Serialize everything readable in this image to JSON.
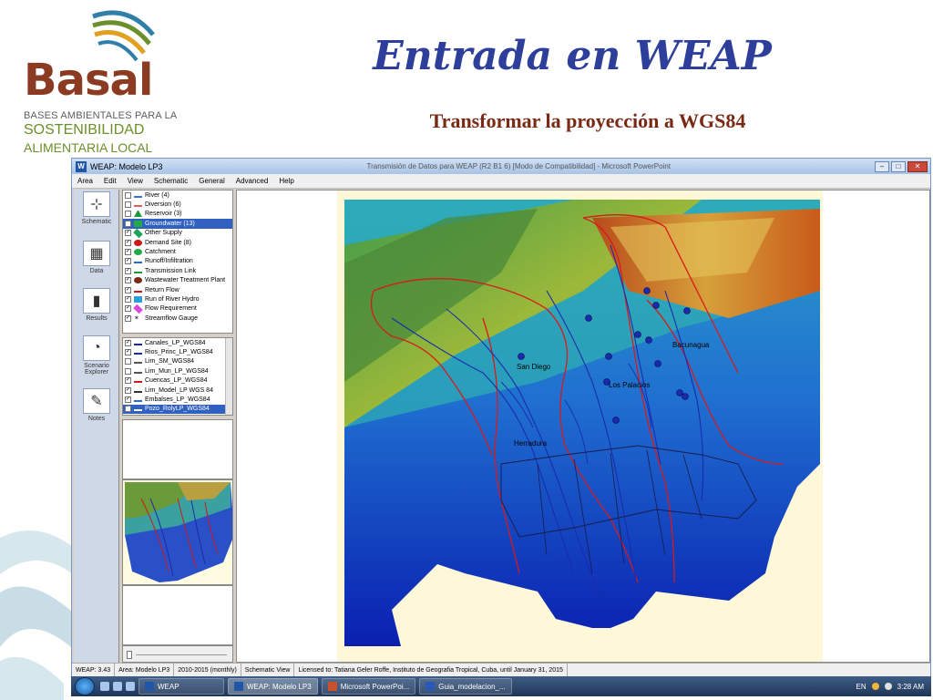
{
  "slide": {
    "title": "Entrada en WEAP",
    "subtitle": "Transformar la proyección a WGS84"
  },
  "logo": {
    "brand": "Basal",
    "line1": "BASES AMBIENTALES PARA LA",
    "line2": "SOSTENIBILIDAD",
    "line3": "ALIMENTARIA LOCAL"
  },
  "window": {
    "title": "WEAP: Modelo LP3",
    "background_title": "Transmisión de Datos para WEAP (R2 B1 6) [Modo de Compatibilidad] - Microsoft PowerPoint",
    "menu": [
      "Area",
      "Edit",
      "View",
      "Schematic",
      "General",
      "Advanced",
      "Help"
    ]
  },
  "views": [
    {
      "label": "Schematic",
      "icon": "schematic-icon"
    },
    {
      "label": "Data",
      "icon": "data-icon"
    },
    {
      "label": "Results",
      "icon": "results-icon"
    },
    {
      "label": "Scenario Explorer",
      "icon": "scenario-explorer-icon"
    },
    {
      "label": "Notes",
      "icon": "notes-icon"
    }
  ],
  "legend": [
    {
      "label": "River (4)",
      "checked": false,
      "symbol": "line",
      "color": "#3a6fd8"
    },
    {
      "label": "Diversion (6)",
      "checked": false,
      "symbol": "line",
      "color": "#e06060"
    },
    {
      "label": "Reservoir (3)",
      "checked": false,
      "symbol": "triangle",
      "color": "#1a9a3a"
    },
    {
      "label": "Groundwater (13)",
      "checked": false,
      "symbol": "square",
      "color": "#22aa44",
      "selected": true
    },
    {
      "label": "Other Supply",
      "checked": true,
      "symbol": "diamond",
      "color": "#1aa55a"
    },
    {
      "label": "Demand Site (8)",
      "checked": true,
      "symbol": "circle",
      "color": "#cc1a1a"
    },
    {
      "label": "Catchment",
      "checked": true,
      "symbol": "circle",
      "color": "#22aa44"
    },
    {
      "label": "Runoff/Infiltration",
      "checked": true,
      "symbol": "dashed",
      "color": "#2a6ad8"
    },
    {
      "label": "Transmission Link",
      "checked": true,
      "symbol": "line",
      "color": "#1a9a3a"
    },
    {
      "label": "Wastewater Treatment Plant",
      "checked": true,
      "symbol": "circle",
      "color": "#7a2a14"
    },
    {
      "label": "Return Flow",
      "checked": true,
      "symbol": "line",
      "color": "#cc1a1a"
    },
    {
      "label": "Run of River Hydro",
      "checked": true,
      "symbol": "square",
      "color": "#2aa0d8"
    },
    {
      "label": "Flow Requirement",
      "checked": true,
      "symbol": "diamond",
      "color": "#d84ad8"
    },
    {
      "label": "Streamflow Gauge",
      "checked": true,
      "symbol": "star",
      "color": "#333333"
    }
  ],
  "layers": [
    {
      "label": "Canales_LP_WGS84",
      "checked": true,
      "color": "#1a2ab0"
    },
    {
      "label": "Rios_Princ_LP_WGS84",
      "checked": true,
      "color": "#1a2ab0"
    },
    {
      "label": "Lim_SM_WGS84",
      "checked": false,
      "color": "#555555"
    },
    {
      "label": "Lim_Mun_LP_WGS84",
      "checked": false,
      "color": "#555555"
    },
    {
      "label": "Cuencas_LP_WGS84",
      "checked": true,
      "color": "#cc1a1a"
    },
    {
      "label": "Lim_Model_LP WGS 84",
      "checked": true,
      "color": "#333333"
    },
    {
      "label": "Embalses_LP_WGS84",
      "checked": true,
      "color": "#2a6ad8"
    },
    {
      "label": "Pozo_RolyLP_WGS84",
      "checked": true,
      "color": "#ffffff",
      "selected": true
    }
  ],
  "map": {
    "labels": [
      "San Diego",
      "Los Palacios",
      "Bacunagua",
      "Herradura"
    ]
  },
  "status": {
    "version": "WEAP: 3.43",
    "area": "Area: Modelo LP3",
    "period": "2010-2015 (monthly)",
    "view": "Schematic View",
    "license": "Licensed to: Tatiana Geler Roffe, Instituto de Geografia Tropical, Cuba, until January 31, 2015"
  },
  "taskbar": {
    "items": [
      "WEAP",
      "WEAP: Modelo LP3",
      "Microsoft PowerPoi...",
      "Guia_modelacion_..."
    ],
    "lang": "EN",
    "time": "3:28 AM"
  },
  "colors": {
    "title": "#2d3f9b",
    "subtitle": "#7a2a14",
    "brand": "#8a3b22",
    "brand_green": "#6b8f2a"
  }
}
